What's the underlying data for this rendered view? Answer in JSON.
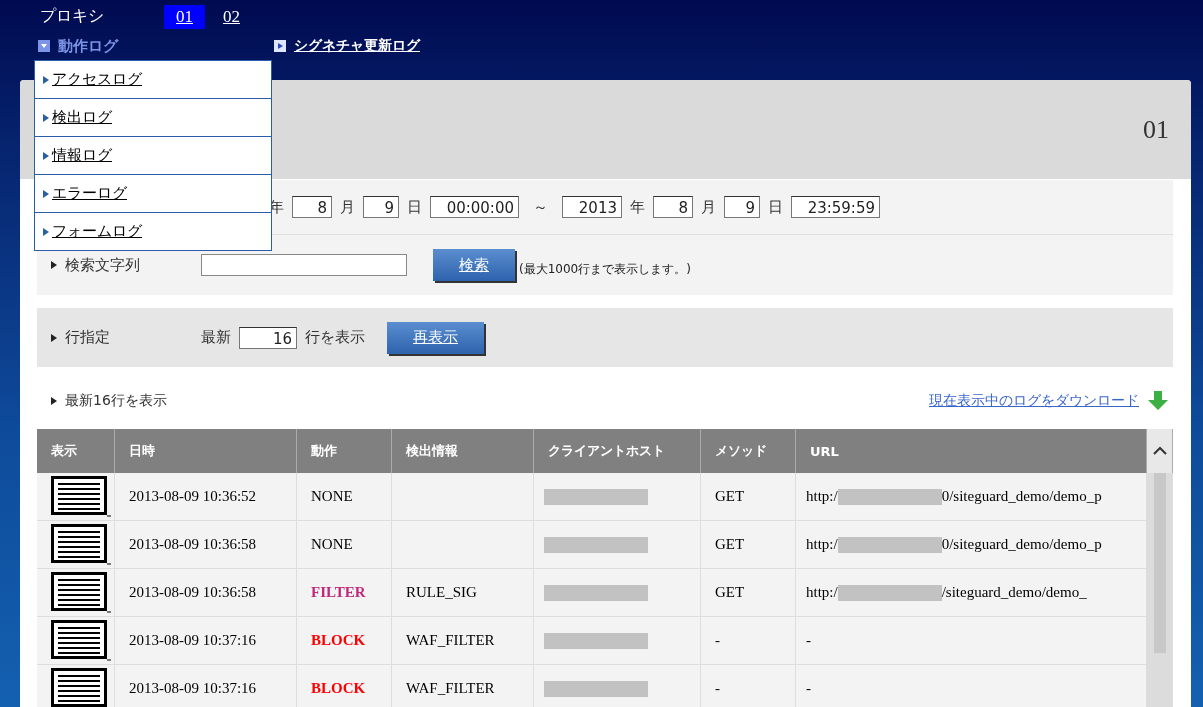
{
  "proxy": {
    "label": "プロキシ",
    "tabs": [
      {
        "label": "01",
        "selected": true
      },
      {
        "label": "02",
        "selected": false
      }
    ]
  },
  "log_menu": {
    "label": "動作ログ",
    "expanded": true,
    "items": [
      "アクセスログ",
      "検出ログ",
      "情報ログ",
      "エラーログ",
      "フォームログ"
    ]
  },
  "signature_link": "シグネチャ更新ログ",
  "panel_title": "01",
  "date_range": {
    "from_year_unit": "年",
    "from_month": "8",
    "month_unit": "月",
    "from_day": "9",
    "day_unit": "日",
    "from_time": "00:00:00",
    "separator": "～",
    "to_year": "2013",
    "to_year_unit": "年",
    "to_month": "8",
    "to_month_unit": "月",
    "to_day": "9",
    "to_day_unit": "日",
    "to_time": "23:59:59"
  },
  "search": {
    "label": "検索文字列",
    "button": "検索",
    "note": "(最大1000行まで表示します。)"
  },
  "rows_spec": {
    "label": "行指定",
    "prefix": "最新",
    "value": "16",
    "suffix": "行を表示",
    "button": "再表示"
  },
  "result_caption": "最新16行を表示",
  "download_link": "現在表示中のログをダウンロード",
  "table": {
    "columns": [
      "表示",
      "日時",
      "動作",
      "検出情報",
      "クライアントホスト",
      "メソッド",
      "URL"
    ],
    "rows": [
      {
        "datetime": "2013-08-09 10:36:52",
        "action": "NONE",
        "color": "#000000",
        "detection": "",
        "method": "GET",
        "url_start": "http:/",
        "url_end": "0/siteguard_demo/demo_p"
      },
      {
        "datetime": "2013-08-09 10:36:58",
        "action": "NONE",
        "color": "#000000",
        "detection": "",
        "method": "GET",
        "url_start": "http:/",
        "url_end": "0/siteguard_demo/demo_p"
      },
      {
        "datetime": "2013-08-09 10:36:58",
        "action": "FILTER",
        "color": "#c0287a",
        "detection": "RULE_SIG",
        "method": "GET",
        "url_start": "http:/",
        "url_end": "/siteguard_demo/demo_"
      },
      {
        "datetime": "2013-08-09 10:37:16",
        "action": "BLOCK",
        "color": "#ff0000",
        "detection": "WAF_FILTER",
        "method": "-",
        "url_start": "-",
        "url_end": ""
      },
      {
        "datetime": "2013-08-09 10:37:16",
        "action": "BLOCK",
        "color": "#ff0000",
        "detection": "WAF_FILTER",
        "method": "-",
        "url_start": "-",
        "url_end": ""
      }
    ]
  }
}
